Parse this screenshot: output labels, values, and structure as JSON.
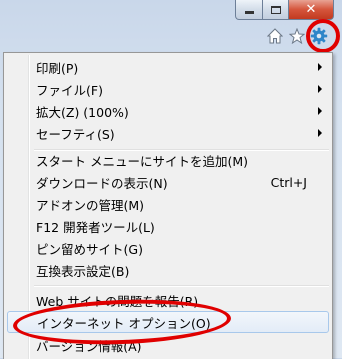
{
  "window": {
    "minimize_glyph": "",
    "close_glyph": "✕"
  },
  "toolbar": {
    "home_icon": "home-icon",
    "favorites_icon": "star-icon",
    "tools_icon": "gear-icon"
  },
  "menu": {
    "items": [
      {
        "label": "印刷(P)",
        "submenu": true
      },
      {
        "label": "ファイル(F)",
        "submenu": true
      },
      {
        "label": "拡大(Z) (100%)",
        "submenu": true
      },
      {
        "label": "セーフティ(S)",
        "submenu": true
      },
      {
        "label": "スタート メニューにサイトを追加(M)"
      },
      {
        "label": "ダウンロードの表示(N)",
        "shortcut": "Ctrl+J"
      },
      {
        "label": "アドオンの管理(M)"
      },
      {
        "label": "F12 開発者ツール(L)"
      },
      {
        "label": "ピン留めサイト(G)"
      },
      {
        "label": "互換表示設定(B)"
      },
      {
        "label": "Web サイトの問題を報告(R)"
      },
      {
        "label": "インターネット オプション(O)"
      },
      {
        "label": "バージョン情報(A)"
      }
    ]
  },
  "highlight_color": "#e00000"
}
